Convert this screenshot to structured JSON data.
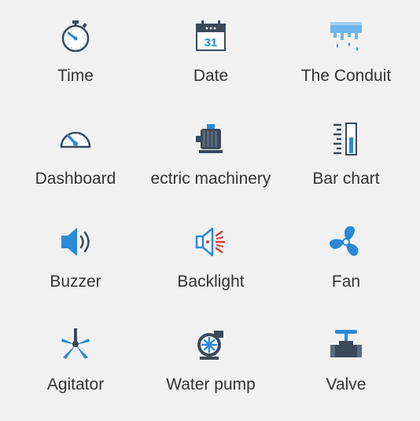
{
  "widgets": [
    {
      "label": "Time",
      "icon": "stopwatch-icon"
    },
    {
      "label": "Date",
      "icon": "calendar-icon",
      "calendar_day": "31"
    },
    {
      "label": "The Conduit",
      "icon": "conduit-icon"
    },
    {
      "label": "Dashboard",
      "icon": "gauge-icon"
    },
    {
      "label": "ectric machinery",
      "icon": "motor-icon"
    },
    {
      "label": "Bar chart",
      "icon": "bar-chart-icon"
    },
    {
      "label": "Buzzer",
      "icon": "speaker-icon"
    },
    {
      "label": "Backlight",
      "icon": "backlight-icon"
    },
    {
      "label": "Fan",
      "icon": "fan-icon"
    },
    {
      "label": "Agitator",
      "icon": "agitator-icon"
    },
    {
      "label": "Water pump",
      "icon": "water-pump-icon"
    },
    {
      "label": "Valve",
      "icon": "valve-icon"
    }
  ],
  "colors": {
    "accent": "#2a8ad6",
    "dark": "#3a4a5a",
    "text": "#333333",
    "red": "#e23b3b",
    "background": "#f1f1f1"
  }
}
